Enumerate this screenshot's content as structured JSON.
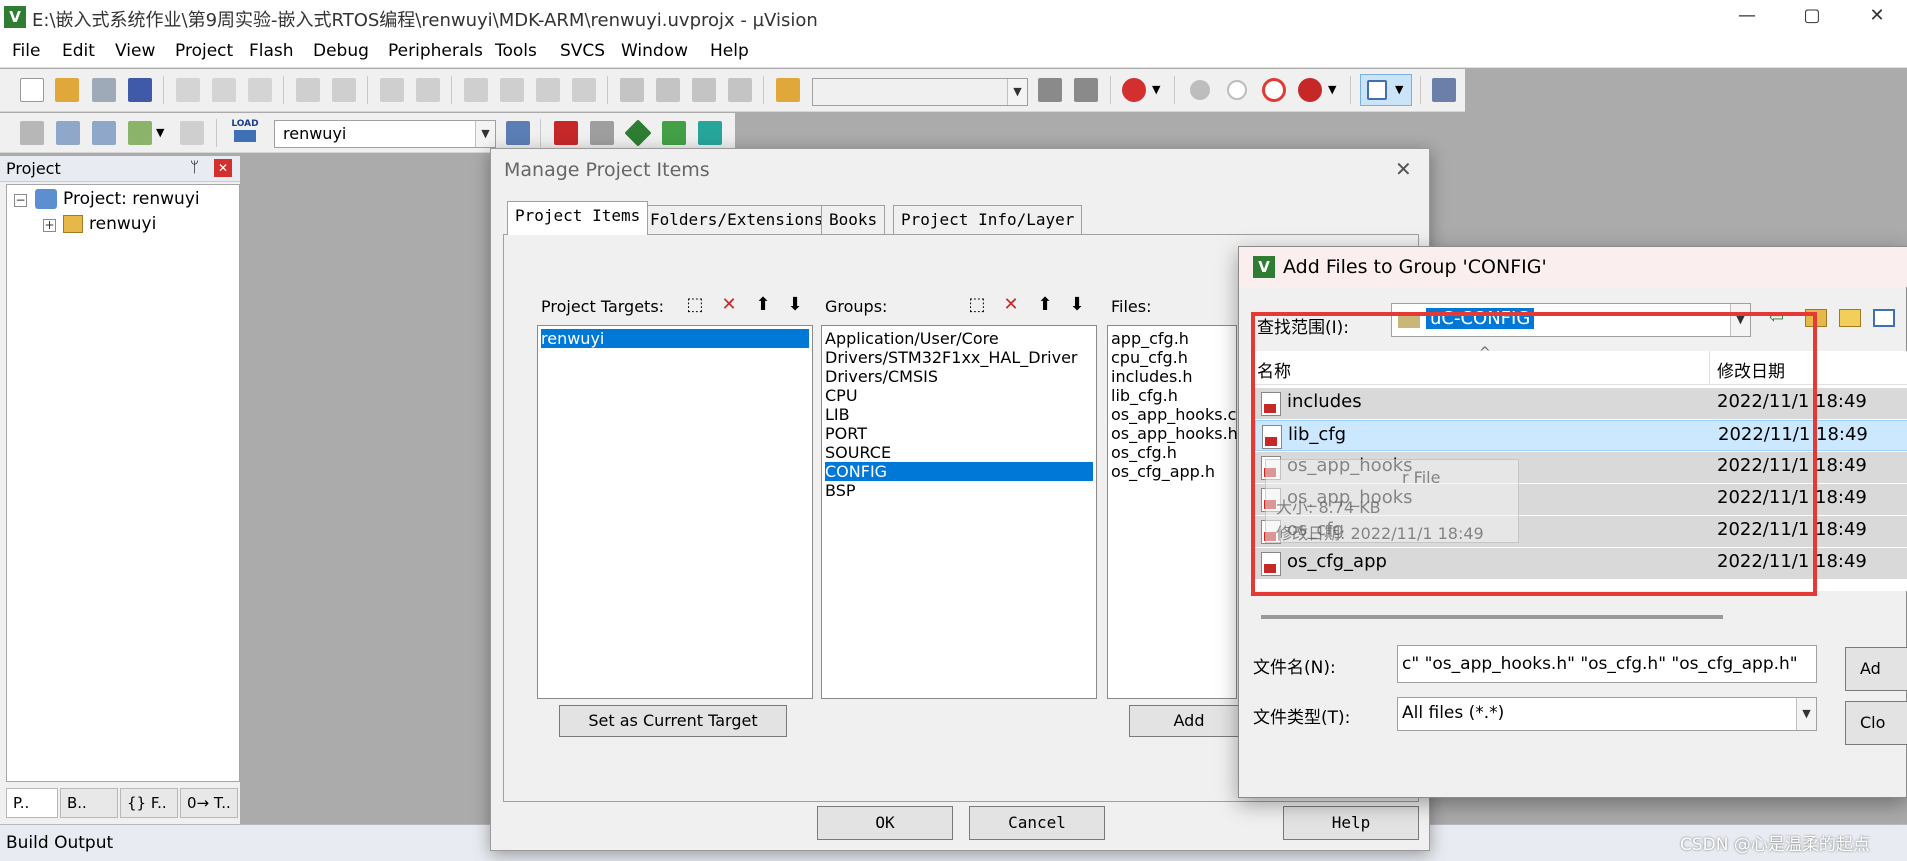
{
  "window": {
    "title": "E:\\嵌入式系统作业\\第9周实验-嵌入式RTOS编程\\renwuyi\\MDK-ARM\\renwuyi.uvprojx - µVision",
    "minimize": "—",
    "maximize": "▢",
    "close": "✕"
  },
  "menu": [
    "File",
    "Edit",
    "View",
    "Project",
    "Flash",
    "Debug",
    "Peripherals",
    "Tools",
    "SVCS",
    "Window",
    "Help"
  ],
  "toolbar2": {
    "load_label": "LOAD",
    "target_select": "renwuyi"
  },
  "project_pane": {
    "title": "Project",
    "pin": "ᛘ",
    "close": "✕",
    "root": "Project: renwuyi",
    "child": "renwuyi",
    "tabs": [
      "P..",
      "B..",
      "{} F..",
      "0→ T.."
    ]
  },
  "build_output": {
    "title": "Build Output"
  },
  "manage_dialog": {
    "title": "Manage Project Items",
    "close": "✕",
    "tabs": [
      "Project Items",
      "Folders/Extensions",
      "Books",
      "Project Info/Layer"
    ],
    "targets": {
      "label": "Project Targets:",
      "items": [
        "renwuyi"
      ],
      "selected": 0
    },
    "groups": {
      "label": "Groups:",
      "items": [
        "Application/User/Core",
        "Drivers/STM32F1xx_HAL_Driver",
        "Drivers/CMSIS",
        "CPU",
        "LIB",
        "PORT",
        "SOURCE",
        "CONFIG",
        "BSP"
      ],
      "selected": 7
    },
    "files": {
      "label": "Files:",
      "items": [
        "app_cfg.h",
        "cpu_cfg.h",
        "includes.h",
        "lib_cfg.h",
        "os_app_hooks.c",
        "os_app_hooks.h",
        "os_cfg.h",
        "os_cfg_app.h"
      ]
    },
    "set_current_target": "Set as Current Target",
    "add_files": "Add",
    "ok": "OK",
    "cancel": "Cancel",
    "help": "Help"
  },
  "add_dialog": {
    "title": "Add Files to Group 'CONFIG'",
    "look_in_label": "查找范围(I):",
    "look_in_value": "uC-CONFIG",
    "col_name": "名称",
    "col_date": "修改日期",
    "rows": [
      {
        "name": "includes",
        "date": "2022/11/1 18:49"
      },
      {
        "name": "lib_cfg",
        "date": "2022/11/1 18:49"
      },
      {
        "name": "os_app_hooks",
        "date": "2022/11/1 18:49"
      },
      {
        "name": "os_app_hooks",
        "date": "2022/11/1 18:49"
      },
      {
        "name": "os_cfg",
        "date": "2022/11/1 18:49"
      },
      {
        "name": "os_cfg_app",
        "date": "2022/11/1 18:49"
      }
    ],
    "tooltip": {
      "line1": "r File",
      "line2": "大小: 8.74 KB",
      "line3": "修改日期: 2022/11/1 18:49"
    },
    "filename_label": "文件名(N):",
    "filename_value": "c\" \"os_app_hooks.h\" \"os_cfg.h\" \"os_cfg_app.h\"",
    "filetype_label": "文件类型(T):",
    "filetype_value": "All files (*.*)",
    "add_button": "Ad",
    "close_button": "Clo"
  },
  "watermark": "CSDN @心是温柔的起点",
  "colors": {
    "selection": "#0078d7",
    "highlight_row": "#cce8ff",
    "annotation": "#e53935"
  }
}
